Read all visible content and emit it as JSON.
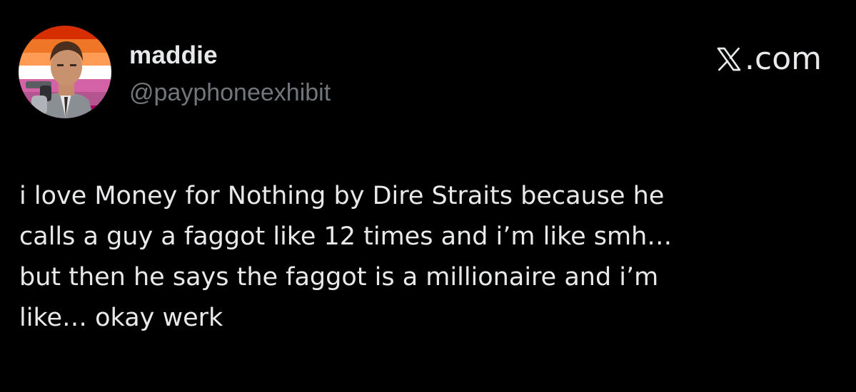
{
  "post": {
    "author": {
      "display_name": "maddie",
      "handle": "@payphoneexhibit",
      "avatar_icon": "user-avatar-icon"
    },
    "brand": {
      "logo_icon": "x-logo-icon",
      "suffix": ".com"
    },
    "text": "i love Money for Nothing by Dire Straits because he\ncalls a guy a faggot like 12 times and i’m like smh…\nbut then he says the faggot is a millionaire and i’m\nlike… okay werk"
  },
  "colors": {
    "background": "#000000",
    "text_primary": "#e7e9ea",
    "text_secondary": "#71767b",
    "flag_stripes": [
      "#d62e00",
      "#ef7627",
      "#ff9b55",
      "#ffffff",
      "#d462a6",
      "#b55590",
      "#a50062"
    ]
  }
}
